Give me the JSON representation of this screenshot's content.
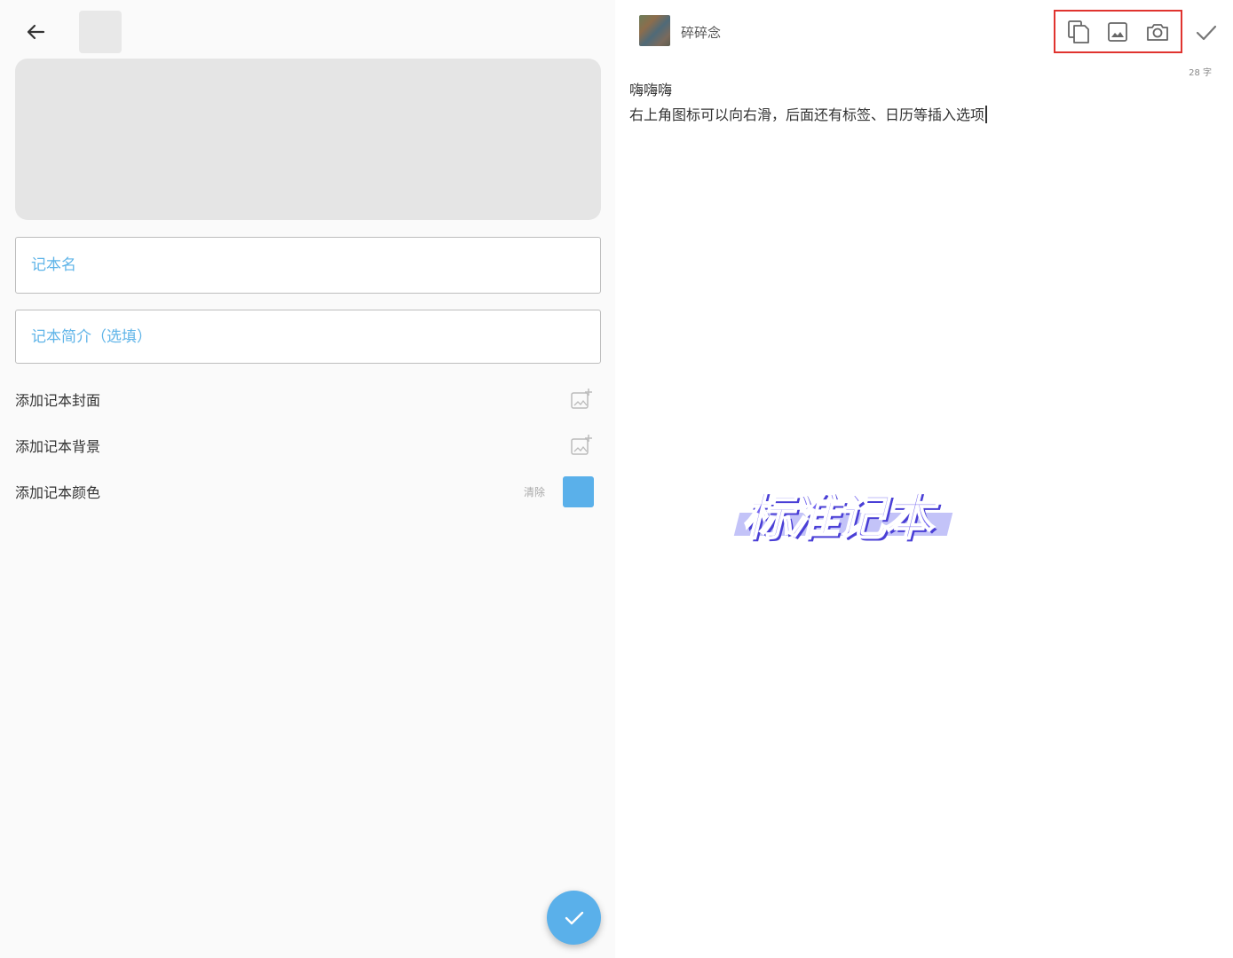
{
  "editor_form": {
    "name_placeholder": "记本名",
    "desc_placeholder": "记本简介（选填）",
    "options": [
      {
        "label": "添加记本封面"
      },
      {
        "label": "添加记本背景"
      },
      {
        "label": "添加记本颜色"
      }
    ],
    "clear_label": "清除",
    "selected_color": "#5ab0ea"
  },
  "note_editor": {
    "app_name": "碎碎念",
    "word_count": "28 字",
    "lines": [
      "嗨嗨嗨",
      "右上角图标可以向右滑，后面还有标签、日历等插入选项"
    ]
  },
  "watermark": {
    "text": "标准记本"
  },
  "colors": {
    "accent": "#5ab0ea",
    "highlight_border": "#e0332f",
    "watermark": "#7466f0"
  }
}
